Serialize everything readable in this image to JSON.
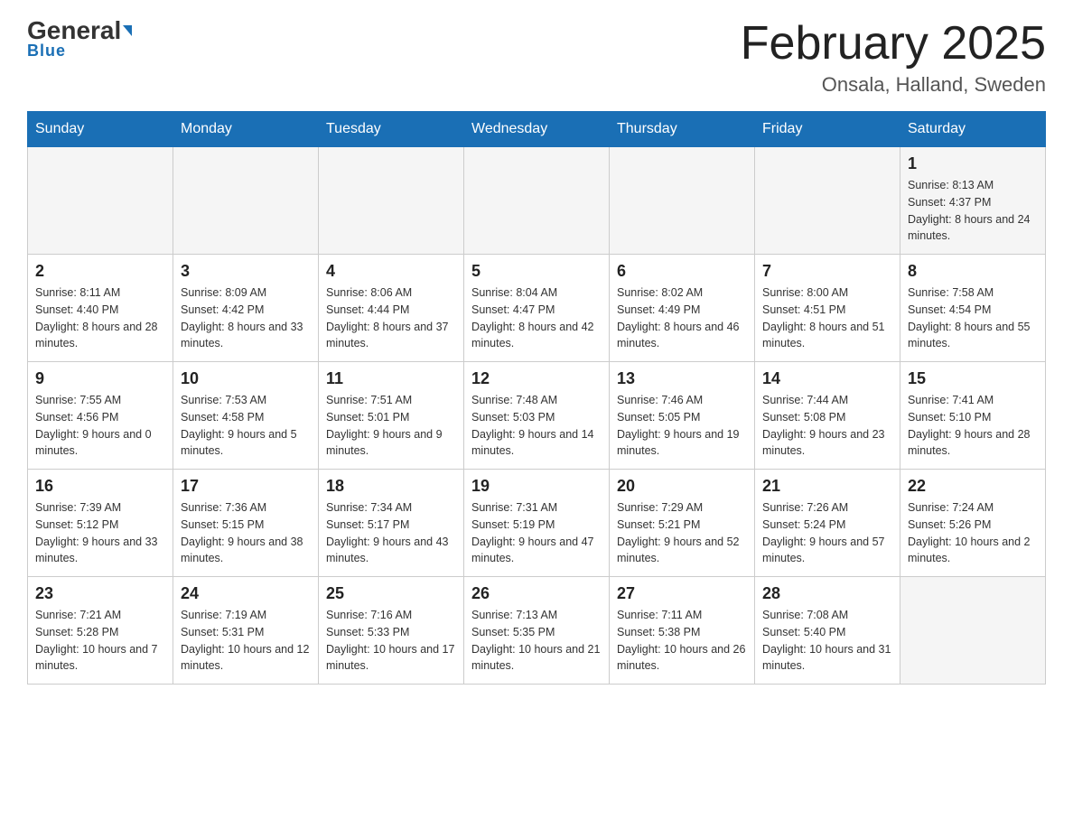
{
  "header": {
    "logo": {
      "general": "General",
      "blue": "Blue"
    },
    "title": "February 2025",
    "location": "Onsala, Halland, Sweden"
  },
  "weekdays": [
    "Sunday",
    "Monday",
    "Tuesday",
    "Wednesday",
    "Thursday",
    "Friday",
    "Saturday"
  ],
  "weeks": [
    [
      null,
      null,
      null,
      null,
      null,
      null,
      {
        "day": "1",
        "sunrise": "Sunrise: 8:13 AM",
        "sunset": "Sunset: 4:37 PM",
        "daylight": "Daylight: 8 hours and 24 minutes."
      }
    ],
    [
      {
        "day": "2",
        "sunrise": "Sunrise: 8:11 AM",
        "sunset": "Sunset: 4:40 PM",
        "daylight": "Daylight: 8 hours and 28 minutes."
      },
      {
        "day": "3",
        "sunrise": "Sunrise: 8:09 AM",
        "sunset": "Sunset: 4:42 PM",
        "daylight": "Daylight: 8 hours and 33 minutes."
      },
      {
        "day": "4",
        "sunrise": "Sunrise: 8:06 AM",
        "sunset": "Sunset: 4:44 PM",
        "daylight": "Daylight: 8 hours and 37 minutes."
      },
      {
        "day": "5",
        "sunrise": "Sunrise: 8:04 AM",
        "sunset": "Sunset: 4:47 PM",
        "daylight": "Daylight: 8 hours and 42 minutes."
      },
      {
        "day": "6",
        "sunrise": "Sunrise: 8:02 AM",
        "sunset": "Sunset: 4:49 PM",
        "daylight": "Daylight: 8 hours and 46 minutes."
      },
      {
        "day": "7",
        "sunrise": "Sunrise: 8:00 AM",
        "sunset": "Sunset: 4:51 PM",
        "daylight": "Daylight: 8 hours and 51 minutes."
      },
      {
        "day": "8",
        "sunrise": "Sunrise: 7:58 AM",
        "sunset": "Sunset: 4:54 PM",
        "daylight": "Daylight: 8 hours and 55 minutes."
      }
    ],
    [
      {
        "day": "9",
        "sunrise": "Sunrise: 7:55 AM",
        "sunset": "Sunset: 4:56 PM",
        "daylight": "Daylight: 9 hours and 0 minutes."
      },
      {
        "day": "10",
        "sunrise": "Sunrise: 7:53 AM",
        "sunset": "Sunset: 4:58 PM",
        "daylight": "Daylight: 9 hours and 5 minutes."
      },
      {
        "day": "11",
        "sunrise": "Sunrise: 7:51 AM",
        "sunset": "Sunset: 5:01 PM",
        "daylight": "Daylight: 9 hours and 9 minutes."
      },
      {
        "day": "12",
        "sunrise": "Sunrise: 7:48 AM",
        "sunset": "Sunset: 5:03 PM",
        "daylight": "Daylight: 9 hours and 14 minutes."
      },
      {
        "day": "13",
        "sunrise": "Sunrise: 7:46 AM",
        "sunset": "Sunset: 5:05 PM",
        "daylight": "Daylight: 9 hours and 19 minutes."
      },
      {
        "day": "14",
        "sunrise": "Sunrise: 7:44 AM",
        "sunset": "Sunset: 5:08 PM",
        "daylight": "Daylight: 9 hours and 23 minutes."
      },
      {
        "day": "15",
        "sunrise": "Sunrise: 7:41 AM",
        "sunset": "Sunset: 5:10 PM",
        "daylight": "Daylight: 9 hours and 28 minutes."
      }
    ],
    [
      {
        "day": "16",
        "sunrise": "Sunrise: 7:39 AM",
        "sunset": "Sunset: 5:12 PM",
        "daylight": "Daylight: 9 hours and 33 minutes."
      },
      {
        "day": "17",
        "sunrise": "Sunrise: 7:36 AM",
        "sunset": "Sunset: 5:15 PM",
        "daylight": "Daylight: 9 hours and 38 minutes."
      },
      {
        "day": "18",
        "sunrise": "Sunrise: 7:34 AM",
        "sunset": "Sunset: 5:17 PM",
        "daylight": "Daylight: 9 hours and 43 minutes."
      },
      {
        "day": "19",
        "sunrise": "Sunrise: 7:31 AM",
        "sunset": "Sunset: 5:19 PM",
        "daylight": "Daylight: 9 hours and 47 minutes."
      },
      {
        "day": "20",
        "sunrise": "Sunrise: 7:29 AM",
        "sunset": "Sunset: 5:21 PM",
        "daylight": "Daylight: 9 hours and 52 minutes."
      },
      {
        "day": "21",
        "sunrise": "Sunrise: 7:26 AM",
        "sunset": "Sunset: 5:24 PM",
        "daylight": "Daylight: 9 hours and 57 minutes."
      },
      {
        "day": "22",
        "sunrise": "Sunrise: 7:24 AM",
        "sunset": "Sunset: 5:26 PM",
        "daylight": "Daylight: 10 hours and 2 minutes."
      }
    ],
    [
      {
        "day": "23",
        "sunrise": "Sunrise: 7:21 AM",
        "sunset": "Sunset: 5:28 PM",
        "daylight": "Daylight: 10 hours and 7 minutes."
      },
      {
        "day": "24",
        "sunrise": "Sunrise: 7:19 AM",
        "sunset": "Sunset: 5:31 PM",
        "daylight": "Daylight: 10 hours and 12 minutes."
      },
      {
        "day": "25",
        "sunrise": "Sunrise: 7:16 AM",
        "sunset": "Sunset: 5:33 PM",
        "daylight": "Daylight: 10 hours and 17 minutes."
      },
      {
        "day": "26",
        "sunrise": "Sunrise: 7:13 AM",
        "sunset": "Sunset: 5:35 PM",
        "daylight": "Daylight: 10 hours and 21 minutes."
      },
      {
        "day": "27",
        "sunrise": "Sunrise: 7:11 AM",
        "sunset": "Sunset: 5:38 PM",
        "daylight": "Daylight: 10 hours and 26 minutes."
      },
      {
        "day": "28",
        "sunrise": "Sunrise: 7:08 AM",
        "sunset": "Sunset: 5:40 PM",
        "daylight": "Daylight: 10 hours and 31 minutes."
      },
      null
    ]
  ]
}
